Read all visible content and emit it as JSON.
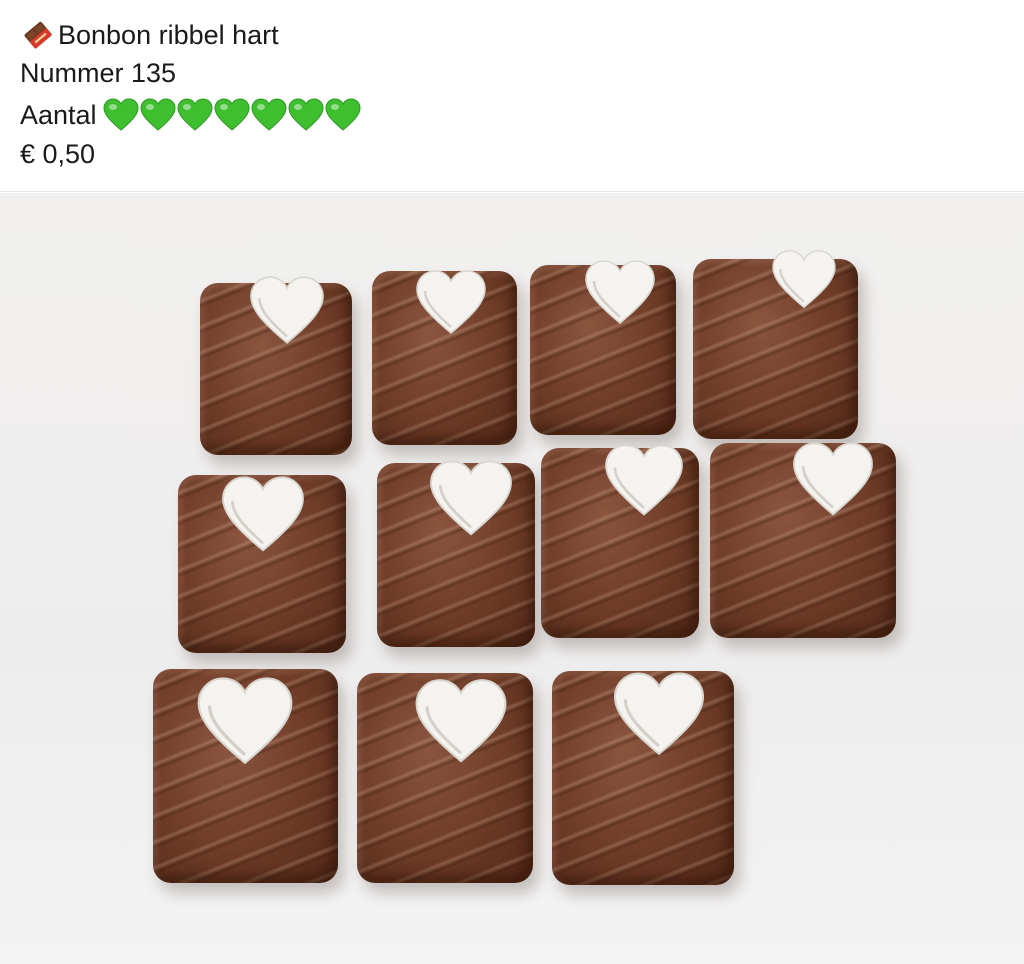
{
  "post": {
    "title": "Bonbon ribbel hart",
    "title_icon": "chocolate-bar-icon",
    "number_line": "Nummer 135",
    "amount_label": "Aantal",
    "amount_hearts": 7,
    "amount_icon": "green-heart-icon",
    "price": "€ 0,50"
  },
  "photo": {
    "subject": "chocolate bonbons with white heart",
    "count": 11
  },
  "colors": {
    "heart_green": "#3fbf2f",
    "chocolate": "#6e3b27",
    "white_heart": "#f4f3ef"
  }
}
